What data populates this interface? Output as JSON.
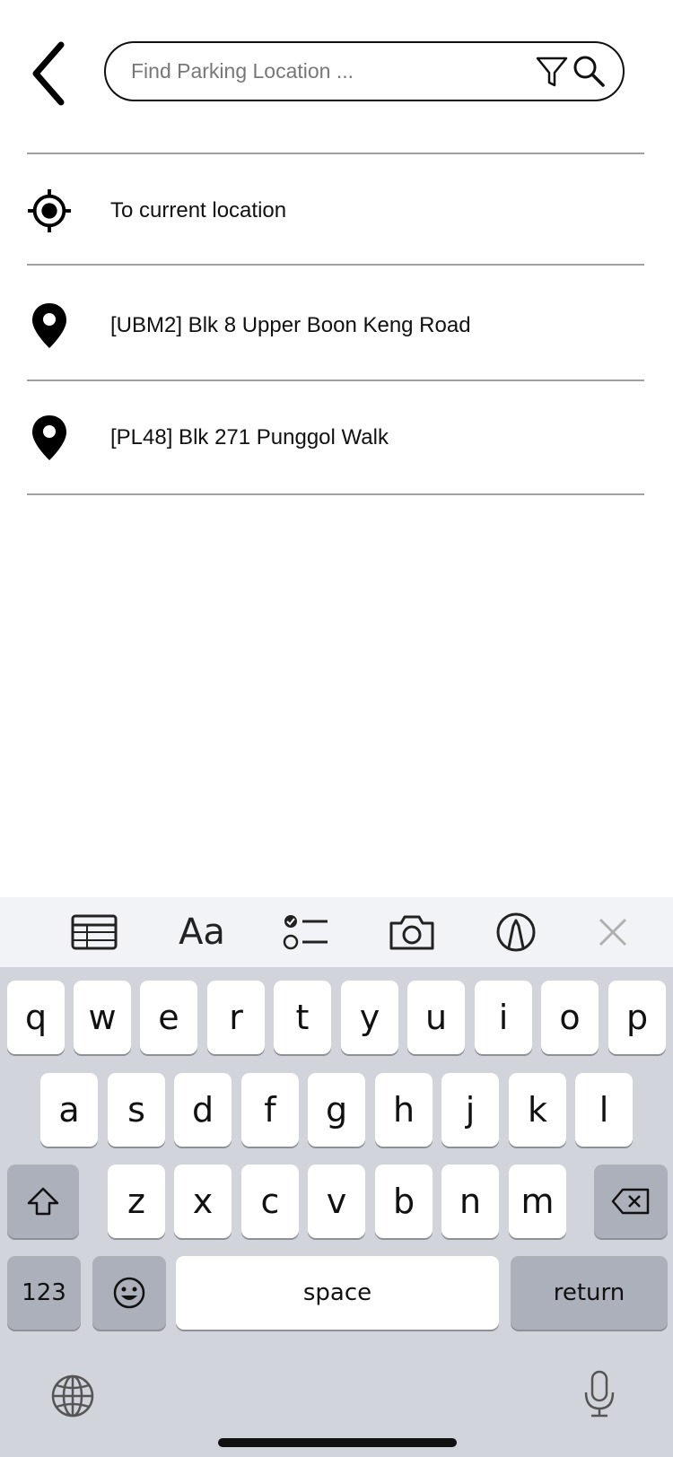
{
  "header": {
    "back_icon": "chevron-left-icon",
    "search": {
      "placeholder": "Find Parking Location ...",
      "value": "",
      "filter_icon": "filter-icon",
      "search_icon": "search-icon"
    }
  },
  "list": {
    "current_location": {
      "icon": "crosshair-icon",
      "label": "To current location"
    },
    "items": [
      {
        "icon": "map-pin-icon",
        "label": "[UBM2] Blk 8 Upper Boon Keng Road"
      },
      {
        "icon": "map-pin-icon",
        "label": "[PL48] Blk 271 Punggol Walk"
      }
    ]
  },
  "keyboard_toolbar": {
    "format_label": "Aa",
    "icons": [
      "table-icon",
      "format-text-icon",
      "checklist-icon",
      "camera-icon",
      "markup-pen-icon",
      "close-icon"
    ]
  },
  "keyboard": {
    "row1": [
      "q",
      "w",
      "e",
      "r",
      "t",
      "y",
      "u",
      "i",
      "o",
      "p"
    ],
    "row2": [
      "a",
      "s",
      "d",
      "f",
      "g",
      "h",
      "j",
      "k",
      "l"
    ],
    "row3": [
      "z",
      "x",
      "c",
      "v",
      "b",
      "n",
      "m"
    ],
    "numbers_label": "123",
    "space_label": "space",
    "return_label": "return",
    "icons": [
      "shift-icon",
      "delete-icon",
      "emoji-icon",
      "globe-icon",
      "microphone-icon"
    ]
  },
  "colors": {
    "keyboard_bg": "#d1d4db",
    "key_bg": "#ffffff",
    "function_key_bg": "#abb0ba",
    "divider": "#a0a0a0"
  }
}
